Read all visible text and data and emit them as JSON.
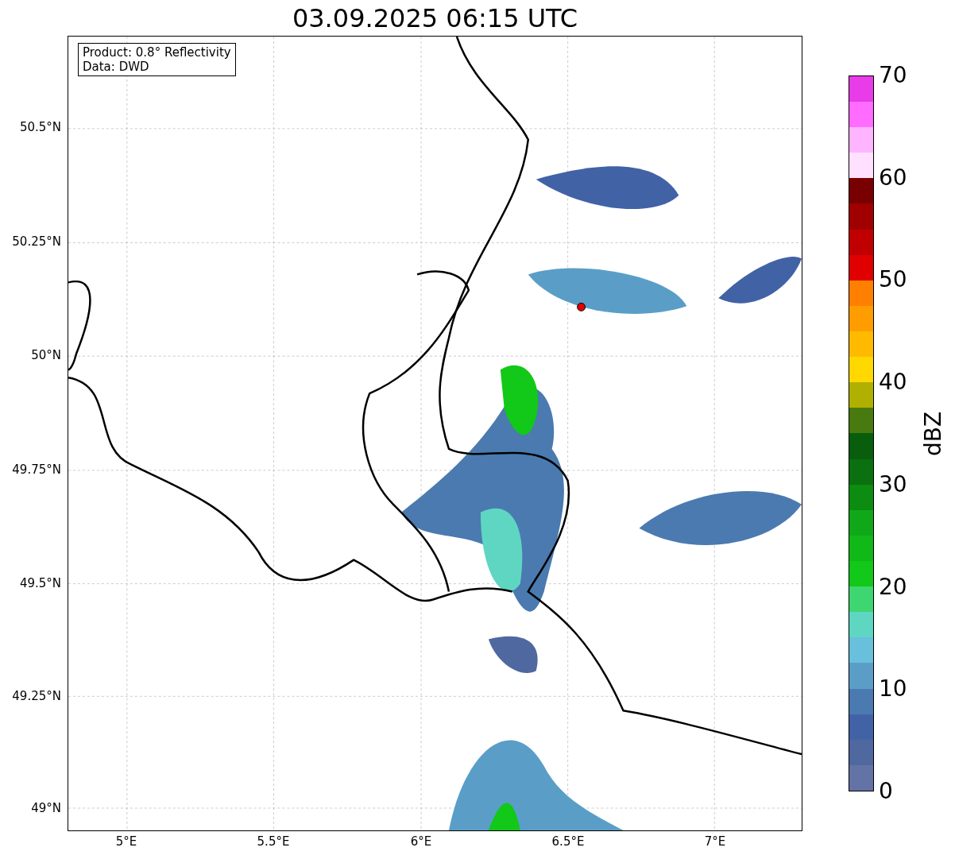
{
  "title": "03.09.2025 06:15 UTC",
  "info_box": [
    "Product: 0.8° Reflectivity",
    "Data: DWD"
  ],
  "y_ticks": [
    "50.5°N",
    "50.25°N",
    "50°N",
    "49.75°N",
    "49.5°N",
    "49.25°N",
    "49°N"
  ],
  "x_ticks": [
    "5°E",
    "5.5°E",
    "6°E",
    "6.5°E",
    "7°E"
  ],
  "colorbar": {
    "label": "dBZ",
    "ticks": [
      "70",
      "60",
      "50",
      "40",
      "30",
      "20",
      "10",
      "0"
    ],
    "bins": [
      {
        "color": "#6373a6"
      },
      {
        "color": "#5068a0"
      },
      {
        "color": "#4262a6"
      },
      {
        "color": "#4a7ab0"
      },
      {
        "color": "#5a9ec8"
      },
      {
        "color": "#68c0dc"
      },
      {
        "color": "#5fd6c2"
      },
      {
        "color": "#3ed670"
      },
      {
        "color": "#12c818"
      },
      {
        "color": "#10b818"
      },
      {
        "color": "#10a818"
      },
      {
        "color": "#0c8c10"
      },
      {
        "color": "#0a7010"
      },
      {
        "color": "#085e0c"
      },
      {
        "color": "#487a10"
      },
      {
        "color": "#b0b000"
      },
      {
        "color": "#ffd800"
      },
      {
        "color": "#ffba00"
      },
      {
        "color": "#ff9c00"
      },
      {
        "color": "#ff8000"
      },
      {
        "color": "#e00000"
      },
      {
        "color": "#c00000"
      },
      {
        "color": "#a00000"
      },
      {
        "color": "#780000"
      },
      {
        "color": "#ffe0ff"
      },
      {
        "color": "#ffb4ff"
      },
      {
        "color": "#ff6cff"
      },
      {
        "color": "#e83ce8"
      }
    ]
  }
}
